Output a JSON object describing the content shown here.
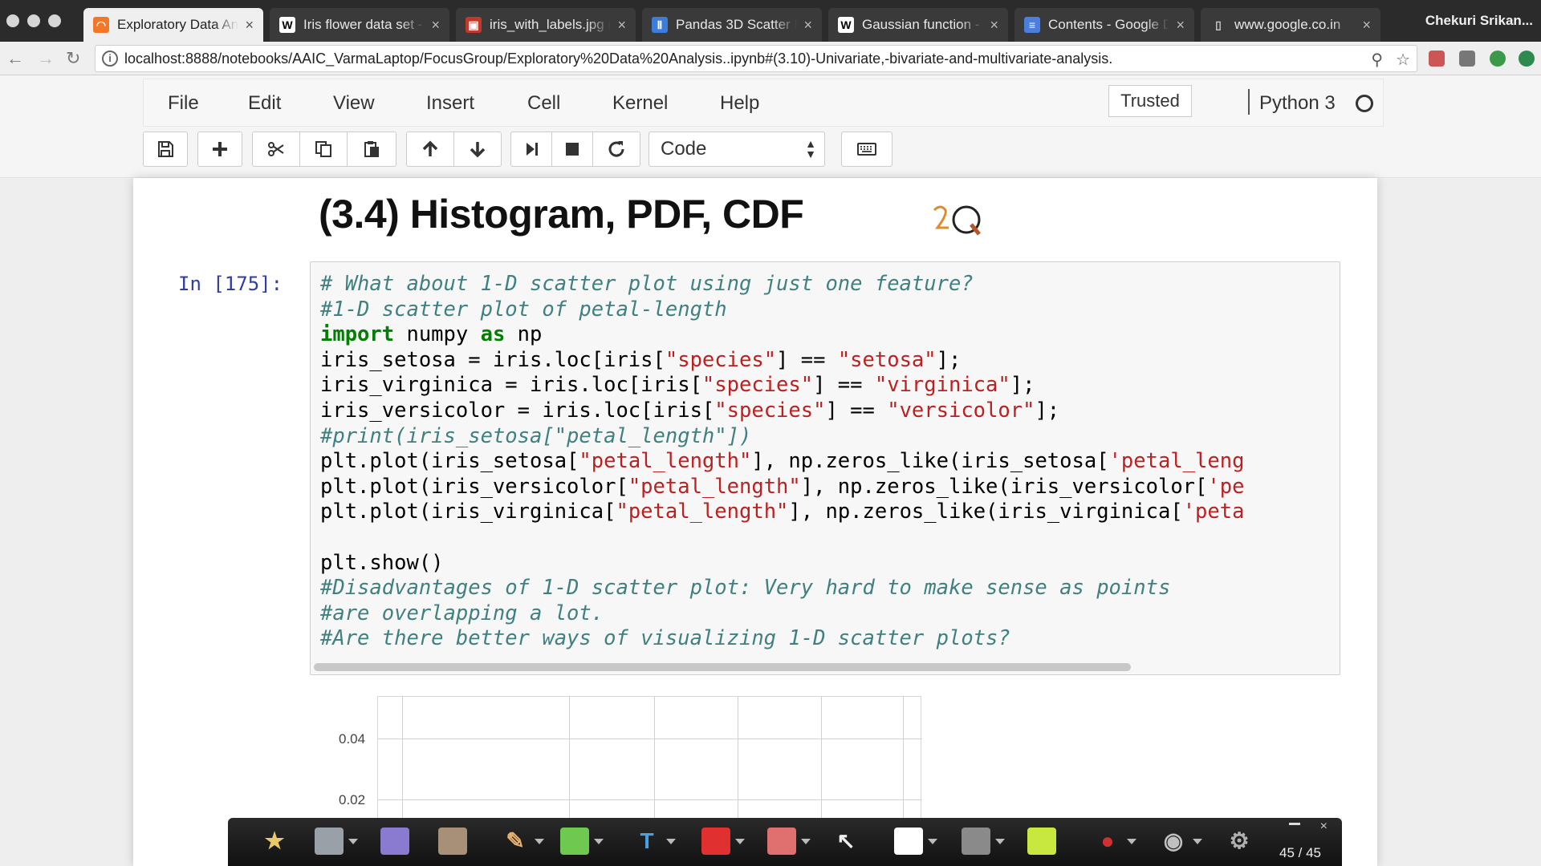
{
  "browser": {
    "tabs": [
      {
        "title": "Exploratory Data An",
        "active": true,
        "icon": "jupyter-icon"
      },
      {
        "title": "Iris flower data set -",
        "active": false,
        "icon": "wikipedia-icon"
      },
      {
        "title": "iris_with_labels.jpg (2",
        "active": false,
        "icon": "image-icon"
      },
      {
        "title": "Pandas 3D Scatter P",
        "active": false,
        "icon": "chart-icon"
      },
      {
        "title": "Gaussian function - V",
        "active": false,
        "icon": "wikipedia-icon"
      },
      {
        "title": "Contents - Google D",
        "active": false,
        "icon": "google-docs-icon"
      },
      {
        "title": "www.google.co.in",
        "active": false,
        "icon": "page-icon"
      }
    ],
    "profile_name": "Chekuri Srikan...",
    "url": "localhost:8888/notebooks/AAIC_VarmaLaptop/FocusGroup/Exploratory%20Data%20Analysis..ipynb#(3.10)-Univariate,-bivariate-and-multivariate-analysis."
  },
  "jupyter": {
    "menu": [
      "File",
      "Edit",
      "View",
      "Insert",
      "Cell",
      "Kernel",
      "Help"
    ],
    "trusted_label": "Trusted",
    "kernel_name": "Python 3",
    "cell_type": "Code",
    "toolbar_icons": [
      "save-icon",
      "plus-icon",
      "cut-icon",
      "copy-icon",
      "paste-icon",
      "arrow-up-icon",
      "arrow-down-icon",
      "run-icon",
      "stop-icon",
      "restart-icon",
      "keyboard-icon"
    ]
  },
  "notebook": {
    "heading": "(3.4) Histogram, PDF, CDF",
    "prompt": "In [175]:",
    "code_lines": [
      [
        {
          "t": "# What about 1-D scatter plot using just one feature?",
          "c": "cm"
        }
      ],
      [
        {
          "t": "#1-D scatter plot of petal-length",
          "c": "cm"
        }
      ],
      [
        {
          "t": "import",
          "c": "kw"
        },
        {
          "t": " numpy ",
          "c": ""
        },
        {
          "t": "as",
          "c": "kw"
        },
        {
          "t": " np",
          "c": ""
        }
      ],
      [
        {
          "t": "iris_setosa = iris.loc[iris[",
          "c": ""
        },
        {
          "t": "\"species\"",
          "c": "st"
        },
        {
          "t": "] == ",
          "c": ""
        },
        {
          "t": "\"setosa\"",
          "c": "st"
        },
        {
          "t": "];",
          "c": ""
        }
      ],
      [
        {
          "t": "iris_virginica = iris.loc[iris[",
          "c": ""
        },
        {
          "t": "\"species\"",
          "c": "st"
        },
        {
          "t": "] == ",
          "c": ""
        },
        {
          "t": "\"virginica\"",
          "c": "st"
        },
        {
          "t": "];",
          "c": ""
        }
      ],
      [
        {
          "t": "iris_versicolor = iris.loc[iris[",
          "c": ""
        },
        {
          "t": "\"species\"",
          "c": "st"
        },
        {
          "t": "] == ",
          "c": ""
        },
        {
          "t": "\"versicolor\"",
          "c": "st"
        },
        {
          "t": "];",
          "c": ""
        }
      ],
      [
        {
          "t": "#print(iris_setosa[\"petal_length\"])",
          "c": "cm"
        }
      ],
      [
        {
          "t": "plt.plot(iris_setosa[",
          "c": ""
        },
        {
          "t": "\"petal_length\"",
          "c": "st"
        },
        {
          "t": "], np.zeros_like(iris_setosa[",
          "c": ""
        },
        {
          "t": "'petal_leng",
          "c": "st"
        }
      ],
      [
        {
          "t": "plt.plot(iris_versicolor[",
          "c": ""
        },
        {
          "t": "\"petal_length\"",
          "c": "st"
        },
        {
          "t": "], np.zeros_like(iris_versicolor[",
          "c": ""
        },
        {
          "t": "'pe",
          "c": "st"
        }
      ],
      [
        {
          "t": "plt.plot(iris_virginica[",
          "c": ""
        },
        {
          "t": "\"petal_length\"",
          "c": "st"
        },
        {
          "t": "], np.zeros_like(iris_virginica[",
          "c": ""
        },
        {
          "t": "'peta",
          "c": "st"
        }
      ],
      [
        {
          "t": "",
          "c": ""
        }
      ],
      [
        {
          "t": "plt.show()",
          "c": ""
        }
      ],
      [
        {
          "t": "#Disadvantages of 1-D scatter plot: Very hard to make sense as points",
          "c": "cm"
        }
      ],
      [
        {
          "t": "#are overlapping a lot.",
          "c": "cm"
        }
      ],
      [
        {
          "t": "#Are there better ways of visualizing 1-D scatter plots?",
          "c": "cm"
        }
      ]
    ],
    "output_plot": {
      "yticks": [
        "0.04",
        "0.02"
      ]
    }
  },
  "pen_toolbar": {
    "page_counter": "45 / 45",
    "tools": [
      "pointer-pen-icon",
      "save-icon",
      "eraser-icon",
      "hand-icon",
      "pencil-icon",
      "highlighter-icon",
      "text-icon",
      "shape-icon",
      "eraser-block-icon",
      "cursor-icon",
      "whiteboard-icon",
      "line-icon",
      "color-swatch-icon",
      "record-icon",
      "webcam-icon",
      "settings-icon"
    ]
  }
}
